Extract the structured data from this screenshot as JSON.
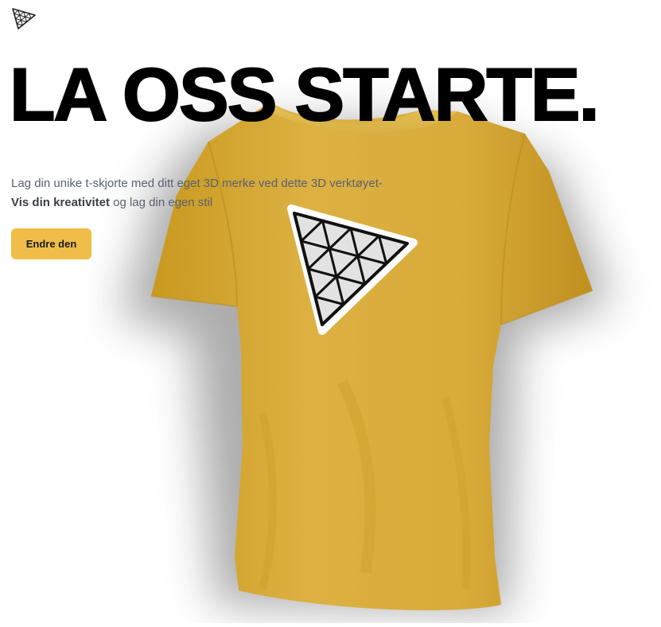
{
  "logo": {
    "icon": "triangle-logo-icon"
  },
  "hero": {
    "headline": "LA OSS STARTE.",
    "subtitle_text": "Lag din unike t-skjorte med ditt eget 3D merke ved dette 3D verktøyet-",
    "subtitle_bold": "Vis din kreativitet",
    "subtitle_end": "og lag din egen stil",
    "cta_label": "Endre den"
  },
  "shirt": {
    "color": "#d8ad3c",
    "decal_icon": "triangle-decal-icon"
  },
  "colors": {
    "accent": "#efbd48",
    "shirt": "#d8ad3c",
    "headline": "#000000",
    "body_text": "#5a6070"
  }
}
